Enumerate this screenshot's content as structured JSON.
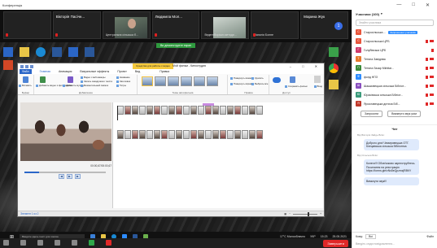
{
  "window": {
    "title": "Конференція",
    "controls": [
      "—",
      "□",
      "✕"
    ]
  },
  "strip": {
    "tiles": [
      {
        "name": "",
        "sub": ""
      },
      {
        "name": "Вікторія Пасічн...",
        "sub": ""
      },
      {
        "name": "",
        "sub": "Центральна сільська б..."
      },
      {
        "name": "Людмила Мол...",
        "sub": ""
      },
      {
        "name": "",
        "sub": "ВедентВирішн-методи..."
      },
      {
        "name": "",
        "sub": "Наталія Бонне"
      },
      {
        "name": "Марина Жук",
        "sub": ""
      }
    ],
    "last_circle": "1"
  },
  "share": {
    "banner": "Ви демонструєте екран"
  },
  "moviemaker": {
    "context_tab": "Средства для работы с видео",
    "window_name": "Мой фильм - Киностудия",
    "tabs": [
      "Файл",
      "Главная",
      "Анимация",
      "Визуальные эффекты",
      "Проект",
      "Вид",
      "Правка"
    ],
    "active_tab": "Главная",
    "ribbon": {
      "paste_label": "Вставить",
      "add_video_label": "Добавить видео и фотографии",
      "add_music_label": "Добавить музыку",
      "cmds_add": [
        "Видео с веб-камеры",
        "Запись закадрового текста",
        "Моментальный снимок"
      ],
      "cmds_text": [
        "Название",
        "Заголовок",
        "Титры"
      ],
      "cmds_edit": [
        "Повернуть влево",
        "Повернуть вправо"
      ],
      "cmds_select": [
        "Удалить",
        "Выбрать все"
      ],
      "save_label": "Сохранить фильм",
      "signin_label": "Вход",
      "groups": [
        "Буфер",
        "Добавление",
        "Темы автофильма",
        "Правка",
        "Доступ"
      ]
    },
    "timecode": "00:00,67/00:00,67",
    "status": "Элемент 1 из 2",
    "status_right": "100%"
  },
  "taskbar": {
    "search_placeholder": "Введите здесь текст для поиска",
    "weather": "17°C Малооблачно",
    "lang": "УКР",
    "time": "15:23",
    "date": "25.05.2021"
  },
  "zoom_controls": {
    "buttons": [
      "Вимкнути звук",
      "Зупинити відео",
      "Безпека",
      "Учасники",
      "Чат",
      "Демонстрація",
      "Запис",
      "Реакції"
    ],
    "end_label": "Завершити"
  },
  "participants": {
    "header": "Учасники (100)",
    "search_placeholder": "Знайти учасника",
    "host_badge": "Запрошення учасників",
    "list": [
      {
        "initial": "С",
        "name": "Старосільська ...",
        "color": "#e8563c"
      },
      {
        "initial": "С",
        "name": "Старосільська ЦРБ",
        "color": "#e8563c"
      },
      {
        "initial": "Г",
        "name": "Голубівська ЦРБ",
        "color": "#d13b6b"
      },
      {
        "initial": "Т",
        "name": "Тетяна Завіднюк",
        "color": "#e87a2c"
      },
      {
        "initial": "П",
        "name": "Тетяна Лазар Mkhitar...",
        "color": "#3a8a3a"
      },
      {
        "initial": "Ф",
        "name": "фонд НПЗ",
        "color": "#2d8cff"
      },
      {
        "initial": "Ш",
        "name": "Шашковецька сільська Бібліот...",
        "color": "#8a4fbf"
      },
      {
        "initial": "Ю",
        "name": "Юрасівська сільська Бібліот...",
        "color": "#3a9a7a"
      },
      {
        "initial": "Я",
        "name": "Ярославецька дитяча Біб...",
        "color": "#c0392b"
      }
    ],
    "invite_label": "Запросити",
    "mute_all_label": "Вимкнути звук усім"
  },
  "chat": {
    "header": "Чат",
    "messages": [
      {
        "meta": "Від Вікторія Зайдь Всім:",
        "text": "Доброго дня! Чемировецька ОТГ. Клецківська сільська бібліотека"
      },
      {
        "meta": "Від Сільська Всім:",
        "text": "Колеги!!! Обов'язково зареєструйтесь. Посилання на реєстрацію https://forms.gle/vNs5eQpzmzjR8NY"
      },
      {
        "meta": "",
        "text": "Вимкнути звук!!!"
      }
    ],
    "to_label": "Кому:",
    "to_value": "Всі",
    "file_label": "Файл",
    "input_placeholder": "Введіть сюди повідомлення..."
  }
}
